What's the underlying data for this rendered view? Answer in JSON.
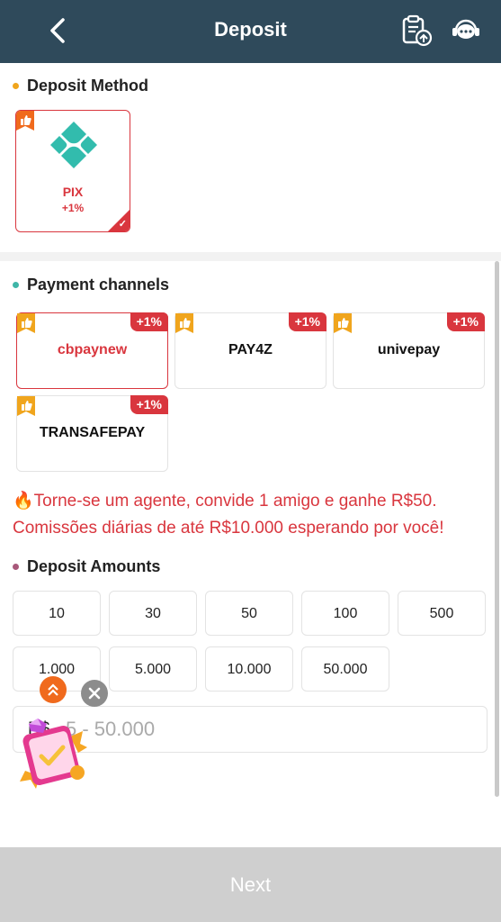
{
  "header": {
    "title": "Deposit",
    "back_icon": "chevron-left-icon",
    "history_icon": "clipboard-upload-icon",
    "support_icon": "customer-service-icon"
  },
  "method_section": {
    "title": "Deposit Method",
    "dot_color": "#f0a51d"
  },
  "methods": [
    {
      "name": "PIX",
      "bonus": "+1%",
      "selected": true
    }
  ],
  "channels_section": {
    "title": "Payment channels",
    "dot_color": "#3fb6a8"
  },
  "channels": [
    {
      "name": "cbpaynew",
      "badge": "+1%",
      "selected": true
    },
    {
      "name": "PAY4Z",
      "badge": "+1%",
      "selected": false
    },
    {
      "name": "univepay",
      "badge": "+1%",
      "selected": false
    },
    {
      "name": "TRANSAFEPAY",
      "badge": "+1%",
      "selected": false
    }
  ],
  "promo": {
    "line1": "Torne-se um agente, convide 1 amigo e ganhe R$50.",
    "line2": "Comissões diárias de até R$10.000 esperando por você!",
    "icon": "fire-icon"
  },
  "amounts_section": {
    "title": "Deposit Amounts",
    "dot_color": "#a8587a"
  },
  "amounts": [
    "10",
    "30",
    "50",
    "100",
    "500",
    "1.000",
    "5.000",
    "10.000",
    "50.000"
  ],
  "amount_input": {
    "currency": "R$",
    "placeholder": "5 - 50.000"
  },
  "next_button": "Next",
  "colors": {
    "header": "#2f4a5b",
    "accent": "#d9363e",
    "disabled": "#cfcfcf"
  }
}
